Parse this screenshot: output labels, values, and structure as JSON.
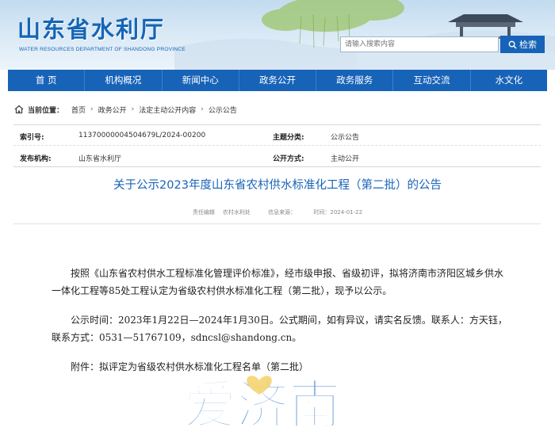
{
  "header": {
    "title": "山东省水利厅",
    "subtitle": "WATER RESOURCES DEPARTMENT OF SHANDONG PROVINCE",
    "search_placeholder": "请输入搜索内容",
    "search_button": "检索"
  },
  "nav": {
    "items": [
      "首 页",
      "机构概况",
      "新闻中心",
      "政务公开",
      "政务服务",
      "互动交流",
      "水文化"
    ]
  },
  "breadcrumb": {
    "prefix": "当前位置：",
    "items": [
      "首页",
      "政务公开",
      "法定主动公开内容",
      "公示公告"
    ],
    "separator": "›"
  },
  "meta": {
    "index_label": "索引号:",
    "index_value": "11370000004504679L/2024-00200",
    "topic_label": "主题分类:",
    "topic_value": "公示公告",
    "publisher_label": "发布机构:",
    "publisher_value": "山东省水利厅",
    "disclosure_label": "公开方式:",
    "disclosure_value": "主动公开"
  },
  "article": {
    "title": "关于公示2023年度山东省农村供水标准化工程（第二批）的公告",
    "info_editor": "责任编辑",
    "info_dept": "农村水利处",
    "info_source": "信息来源：",
    "info_time": "时间：2024-01-22",
    "p1": "按照《山东省农村供水工程标准化管理评价标准》，经市级申报、省级初评，拟将济南市济阳区城乡供水一体化工程等85处工程认定为省级农村供水标准化工程（第二批），现予以公示。",
    "p2": "公示时间：2023年1月22日—2024年1月30日。公式期间，如有异议，请实名反馈。联系人：方天钰，联系方式：0531—51767109，sdncsl@shandong.cn。",
    "p3": "附件：拟评定为省级农村供水标准化工程名单（第二批）"
  },
  "watermark": {
    "text": "爱济南"
  },
  "colors": {
    "brand": "#1763b8",
    "title_blue": "#1565b5"
  }
}
